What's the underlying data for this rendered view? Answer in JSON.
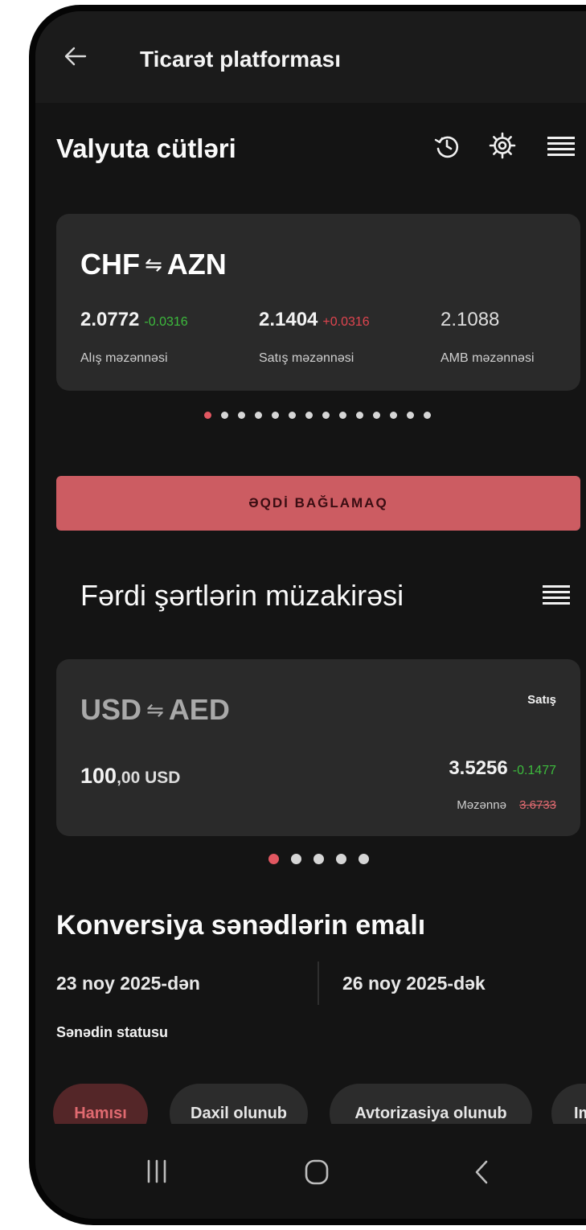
{
  "header": {
    "title": "Ticarət platforması"
  },
  "currency_pairs": {
    "title": "Valyuta cütləri",
    "card": {
      "base": "CHF",
      "quote": "AZN",
      "swap_symbol": "⇋",
      "buy_rate": "2.0772",
      "buy_change": "-0.0316",
      "buy_label": "Alış məzənnəsi",
      "sell_rate": "2.1404",
      "sell_change": "+0.0316",
      "sell_label": "Satış məzənnəsi",
      "cb_rate": "2.1088",
      "cb_label": "AMB məzənnəsi"
    },
    "pagination": {
      "total": 14,
      "active": 0
    }
  },
  "deal_button": {
    "label": "ƏQDİ BAĞLAMAQ"
  },
  "negotiation": {
    "title": "Fərdi şərtlərin müzakirəsi",
    "card": {
      "base": "USD",
      "quote": "AED",
      "swap_symbol": "⇋",
      "side": "Satış",
      "amount_int": "100",
      "amount_dec": ",00 USD",
      "rate": "3.5256",
      "rate_change": "-0.1477",
      "rate_label": "Məzənnə",
      "old_rate": "3.6733"
    },
    "pagination": {
      "total": 5,
      "active": 0
    }
  },
  "conversion": {
    "title": "Konversiya sənədlərin emalı",
    "date_from": "23 noy 2025-dən",
    "date_to": "26 noy 2025-dək",
    "status_label": "Sənədin statusu",
    "chips": [
      "Hamısı",
      "Daxil olunub",
      "Avtorizasiya olunub",
      "Im"
    ],
    "active_chip": 0
  },
  "icons": {
    "back": "arrow-left-icon",
    "history": "history-icon",
    "settings": "gear-icon",
    "menu": "list-icon",
    "nav_recent": "recent-apps-icon",
    "nav_home": "home-icon",
    "nav_back": "chevron-left-icon"
  },
  "colors": {
    "accent": "#cc5c62",
    "positive": "#3dbb3d",
    "negative": "#e0454f",
    "card": "#2a2a2a",
    "background": "#141414"
  }
}
